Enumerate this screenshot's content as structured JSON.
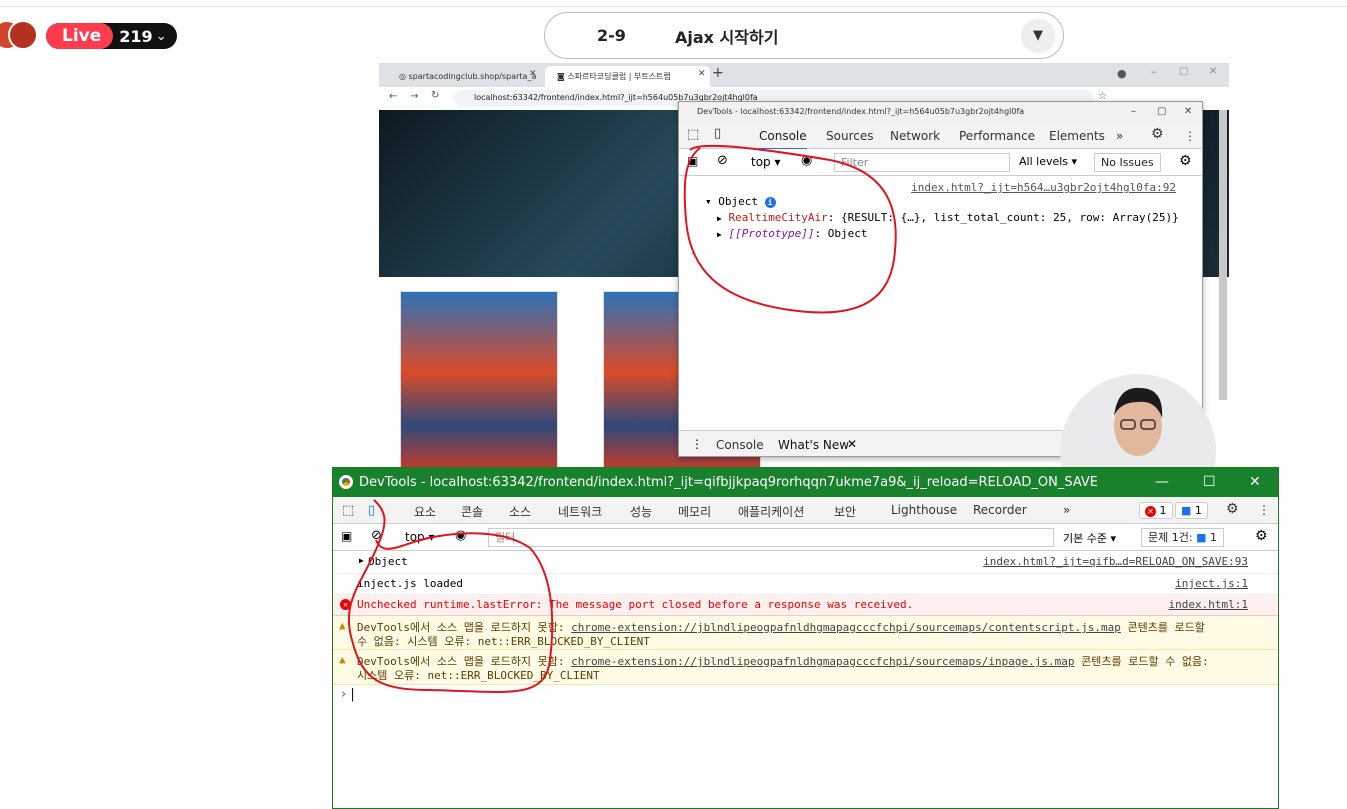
{
  "live": {
    "label": "Live",
    "viewers": "219"
  },
  "lesson": {
    "number": "2-9",
    "title": "Ajax 시작하기"
  },
  "browser": {
    "tabs": [
      {
        "label": "spartacodingclub.shop/sparta_a"
      },
      {
        "label": "스파르타코딩클럽 | 부트스트랩"
      }
    ],
    "url": "localhost:63342/frontend/index.html?_ijt=h564u05b7u3gbr2ojt4hgl0fa"
  },
  "devtools_small": {
    "title": "DevTools - localhost:63342/frontend/index.html?_ijt=h564u05b7u3gbr2ojt4hgl0fa",
    "tabs": [
      "Console",
      "Sources",
      "Network",
      "Performance",
      "Elements"
    ],
    "context": "top",
    "filter_placeholder": "Filter",
    "levels": "All levels",
    "issues": "No Issues",
    "source_link": "index.html?_ijt=h564…u3gbr2ojt4hgl0fa:92",
    "object_label": "Object",
    "info_badge": "i",
    "row1_key": "RealtimeCityAir",
    "row1_value": ": {RESULT: {…}, list_total_count: 25, row: Array(25)}",
    "row2_key": "[[Prototype]]",
    "row2_value": ": Object",
    "drawer_tabs": [
      "Console",
      "What's New"
    ]
  },
  "devtools_big": {
    "title": "DevTools - localhost:63342/frontend/index.html?_ijt=qifbjjkpaq9rorhqqn7ukme7a9&_ij_reload=RELOAD_ON_SAVE",
    "tabs": [
      "요소",
      "콘솔",
      "소스",
      "네트워크",
      "성능",
      "메모리",
      "애플리케이션",
      "보안",
      "Lighthouse",
      "Recorder"
    ],
    "error_count": "1",
    "message_count": "1",
    "context": "top",
    "filter_placeholder": "필터",
    "levels": "기본 수준",
    "issues_label": "문제 1건:",
    "issues_count": "1",
    "rows": [
      {
        "text": "Object",
        "source": "index.html?_ijt=qifb…d=RELOAD_ON_SAVE:93"
      },
      {
        "text": "inject.js loaded",
        "source": "inject.js:1"
      },
      {
        "text": "Unchecked runtime.lastError: The message port closed before a response was received.",
        "source": "index.html:1"
      }
    ],
    "warn1": {
      "prefix": "DevTools에서 소스 맵을 로드하지 못함: ",
      "link": "chrome-extension://jblndlipeogpafnldhgmapagcccfchpi/sourcemaps/contentscript.js.map",
      "suffix": " 콘텐츠를 로드할",
      "line2": "수 없음: 시스템 오류: net::ERR_BLOCKED_BY_CLIENT"
    },
    "warn2": {
      "prefix": "DevTools에서 소스 맵을 로드하지 못함: ",
      "link": "chrome-extension://jblndlipeogpafnldhgmapagcccfchpi/sourcemaps/inpage.js.map",
      "suffix": " 콘텐츠를 로드할 수 없음:",
      "line2": "시스템 오류: net::ERR_BLOCKED_BY_CLIENT"
    },
    "prompt": "›"
  },
  "colors": {
    "live": "#ff3b4e",
    "devtools_titlebar": "#17812b",
    "annotation": "#e0141e",
    "error": "#e00000"
  }
}
